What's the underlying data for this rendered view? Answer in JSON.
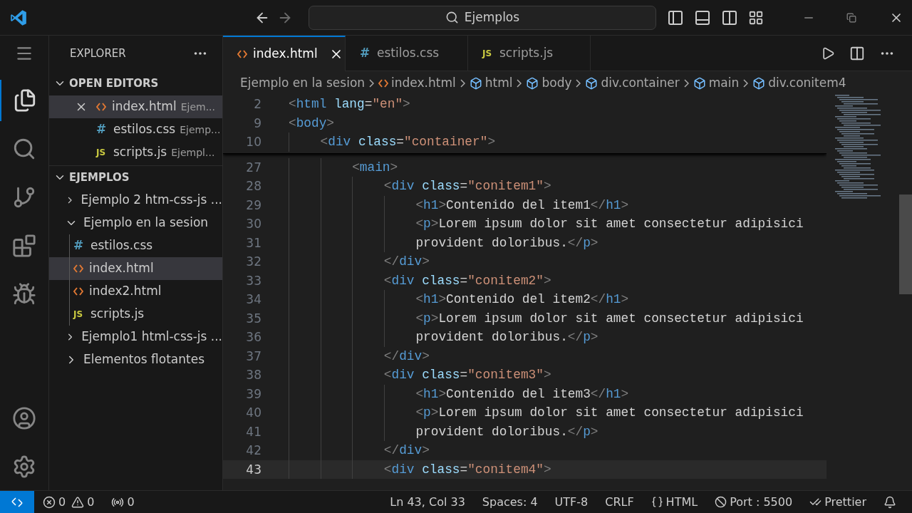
{
  "title_bar": {
    "search": "Ejemplos"
  },
  "sidebar": {
    "title": "EXPLORER",
    "open_editors": {
      "title": "OPEN EDITORS",
      "expanded": true,
      "items": [
        {
          "kind": "html",
          "name": "index.html",
          "folder": "Ejem...",
          "selected": true
        },
        {
          "kind": "css",
          "glyph": "#",
          "name": "estilos.css",
          "folder": "Ejemp...",
          "selected": false
        },
        {
          "kind": "js",
          "glyph": "JS",
          "name": "scripts.js",
          "folder": "Ejempl...",
          "selected": false
        }
      ]
    },
    "workspace": {
      "title": "EJEMPLOS",
      "expanded": true,
      "items": [
        {
          "kind": "folder",
          "name": "Ejemplo 2 htm-css-js ...",
          "expanded": false,
          "selected": false
        },
        {
          "kind": "folder",
          "name": "Ejemplo en la sesion",
          "expanded": true,
          "selected": false,
          "children": [
            {
              "kind": "css",
              "glyph": "#",
              "name": "estilos.css",
              "selected": false
            },
            {
              "kind": "html",
              "name": "index.html",
              "selected": true
            },
            {
              "kind": "html",
              "name": "index2.html",
              "selected": false
            },
            {
              "kind": "js",
              "glyph": "JS",
              "name": "scripts.js",
              "selected": false
            }
          ]
        },
        {
          "kind": "folder",
          "name": "Ejemplo1 html-css-js ...",
          "expanded": false,
          "selected": false
        },
        {
          "kind": "folder",
          "name": "Elementos flotantes",
          "expanded": false,
          "selected": false
        }
      ]
    }
  },
  "tabs": [
    {
      "kind": "html",
      "name": "index.html",
      "selected": true
    },
    {
      "kind": "css",
      "glyph": "#",
      "name": "estilos.css",
      "selected": false
    },
    {
      "kind": "js",
      "glyph": "JS",
      "name": "scripts.js",
      "selected": false
    }
  ],
  "breadcrumbs": [
    {
      "kind": "folder",
      "label": "Ejemplo en la sesion"
    },
    {
      "kind": "html",
      "label": "index.html"
    },
    {
      "kind": "element",
      "label": "html"
    },
    {
      "kind": "element",
      "label": "body"
    },
    {
      "kind": "element",
      "label": "div.container"
    },
    {
      "kind": "element",
      "label": "main"
    },
    {
      "kind": "element",
      "label": "div.conitem4"
    }
  ],
  "sticky_lines": [
    {
      "number": "2",
      "tokens": [
        {
          "kind": "punct",
          "text": "<"
        },
        {
          "kind": "tag",
          "text": "html"
        },
        {
          "kind": "attr",
          "text": " lang"
        },
        {
          "kind": "plain",
          "text": "="
        },
        {
          "kind": "string",
          "text": "\"en\""
        },
        {
          "kind": "punct",
          "text": ">"
        }
      ]
    },
    {
      "number": "9",
      "tokens": [
        {
          "kind": "punct",
          "text": "<"
        },
        {
          "kind": "tag",
          "text": "body"
        },
        {
          "kind": "punct",
          "text": ">"
        }
      ],
      "children": [
        {
          "number": "10",
          "tokens": [
            {
              "kind": "punct",
              "text": "<"
            },
            {
              "kind": "tag",
              "text": "div"
            },
            {
              "kind": "attr",
              "text": " class"
            },
            {
              "kind": "plain",
              "text": "="
            },
            {
              "kind": "string",
              "text": "\"container\""
            },
            {
              "kind": "punct",
              "text": ">"
            }
          ]
        }
      ]
    }
  ],
  "lines": [
    {
      "number": "27",
      "current": false,
      "tokens": [
        {
          "kind": "punct",
          "text": "<"
        },
        {
          "kind": "tag",
          "text": "main"
        },
        {
          "kind": "punct",
          "text": ">"
        }
      ],
      "children": [
        {
          "number": "28",
          "current": false,
          "tokens": [
            {
              "kind": "punct",
              "text": "<"
            },
            {
              "kind": "tag",
              "text": "div"
            },
            {
              "kind": "attr",
              "text": " class"
            },
            {
              "kind": "plain",
              "text": "="
            },
            {
              "kind": "string",
              "text": "\"conitem1\""
            },
            {
              "kind": "punct",
              "text": ">"
            }
          ],
          "children": [
            {
              "number": "29",
              "current": false,
              "tokens": [
                {
                  "kind": "punct",
                  "text": "<"
                },
                {
                  "kind": "tag",
                  "text": "h1"
                },
                {
                  "kind": "punct",
                  "text": ">"
                },
                {
                  "kind": "plain",
                  "text": "Contenido del item1"
                },
                {
                  "kind": "punct",
                  "text": "</"
                },
                {
                  "kind": "tag",
                  "text": "h1"
                },
                {
                  "kind": "punct",
                  "text": ">"
                }
              ]
            },
            {
              "number": "30",
              "current": false,
              "tokens": [
                {
                  "kind": "punct",
                  "text": "<"
                },
                {
                  "kind": "tag",
                  "text": "p"
                },
                {
                  "kind": "punct",
                  "text": ">"
                },
                {
                  "kind": "plain",
                  "text": "Lorem ipsum dolor sit amet consectetur adipisici"
                }
              ]
            },
            {
              "number": "31",
              "current": false,
              "tokens": [
                {
                  "kind": "plain",
                  "text": "provident doloribus."
                },
                {
                  "kind": "punct",
                  "text": "</"
                },
                {
                  "kind": "tag",
                  "text": "p"
                },
                {
                  "kind": "punct",
                  "text": ">"
                }
              ]
            }
          ]
        },
        {
          "number": "32",
          "current": false,
          "tokens": [
            {
              "kind": "punct",
              "text": "</"
            },
            {
              "kind": "tag",
              "text": "div"
            },
            {
              "kind": "punct",
              "text": ">"
            }
          ]
        },
        {
          "number": "33",
          "current": false,
          "tokens": [
            {
              "kind": "punct",
              "text": "<"
            },
            {
              "kind": "tag",
              "text": "div"
            },
            {
              "kind": "attr",
              "text": " class"
            },
            {
              "kind": "plain",
              "text": "="
            },
            {
              "kind": "string",
              "text": "\"conitem2\""
            },
            {
              "kind": "punct",
              "text": ">"
            }
          ],
          "children": [
            {
              "number": "34",
              "current": false,
              "tokens": [
                {
                  "kind": "punct",
                  "text": "<"
                },
                {
                  "kind": "tag",
                  "text": "h1"
                },
                {
                  "kind": "punct",
                  "text": ">"
                },
                {
                  "kind": "plain",
                  "text": "Contenido del item2"
                },
                {
                  "kind": "punct",
                  "text": "</"
                },
                {
                  "kind": "tag",
                  "text": "h1"
                },
                {
                  "kind": "punct",
                  "text": ">"
                }
              ]
            },
            {
              "number": "35",
              "current": false,
              "tokens": [
                {
                  "kind": "punct",
                  "text": "<"
                },
                {
                  "kind": "tag",
                  "text": "p"
                },
                {
                  "kind": "punct",
                  "text": ">"
                },
                {
                  "kind": "plain",
                  "text": "Lorem ipsum dolor sit amet consectetur adipisici"
                }
              ]
            },
            {
              "number": "36",
              "current": false,
              "tokens": [
                {
                  "kind": "plain",
                  "text": "provident doloribus."
                },
                {
                  "kind": "punct",
                  "text": "</"
                },
                {
                  "kind": "tag",
                  "text": "p"
                },
                {
                  "kind": "punct",
                  "text": ">"
                }
              ]
            }
          ]
        },
        {
          "number": "37",
          "current": false,
          "tokens": [
            {
              "kind": "punct",
              "text": "</"
            },
            {
              "kind": "tag",
              "text": "div"
            },
            {
              "kind": "punct",
              "text": ">"
            }
          ]
        },
        {
          "number": "38",
          "current": false,
          "tokens": [
            {
              "kind": "punct",
              "text": "<"
            },
            {
              "kind": "tag",
              "text": "div"
            },
            {
              "kind": "attr",
              "text": " class"
            },
            {
              "kind": "plain",
              "text": "="
            },
            {
              "kind": "string",
              "text": "\"conitem3\""
            },
            {
              "kind": "punct",
              "text": ">"
            }
          ],
          "children": [
            {
              "number": "39",
              "current": false,
              "tokens": [
                {
                  "kind": "punct",
                  "text": "<"
                },
                {
                  "kind": "tag",
                  "text": "h1"
                },
                {
                  "kind": "punct",
                  "text": ">"
                },
                {
                  "kind": "plain",
                  "text": "Contenido del item3"
                },
                {
                  "kind": "punct",
                  "text": "</"
                },
                {
                  "kind": "tag",
                  "text": "h1"
                },
                {
                  "kind": "punct",
                  "text": ">"
                }
              ]
            },
            {
              "number": "40",
              "current": false,
              "tokens": [
                {
                  "kind": "punct",
                  "text": "<"
                },
                {
                  "kind": "tag",
                  "text": "p"
                },
                {
                  "kind": "punct",
                  "text": ">"
                },
                {
                  "kind": "plain",
                  "text": "Lorem ipsum dolor sit amet consectetur adipisici"
                }
              ]
            },
            {
              "number": "41",
              "current": false,
              "tokens": [
                {
                  "kind": "plain",
                  "text": "provident doloribus."
                },
                {
                  "kind": "punct",
                  "text": "</"
                },
                {
                  "kind": "tag",
                  "text": "p"
                },
                {
                  "kind": "punct",
                  "text": ">"
                }
              ]
            }
          ]
        },
        {
          "number": "42",
          "current": false,
          "tokens": [
            {
              "kind": "punct",
              "text": "</"
            },
            {
              "kind": "tag",
              "text": "div"
            },
            {
              "kind": "punct",
              "text": ">"
            }
          ]
        },
        {
          "number": "43",
          "current": true,
          "tokens": [
            {
              "kind": "punct",
              "text": "<"
            },
            {
              "kind": "tag",
              "text": "div"
            },
            {
              "kind": "attr",
              "text": " class"
            },
            {
              "kind": "plain",
              "text": "="
            },
            {
              "kind": "string",
              "text": "\"conitem4\""
            },
            {
              "kind": "punct",
              "text": ">"
            }
          ]
        }
      ]
    }
  ],
  "status_bar": {
    "errors": "0",
    "warnings": "0",
    "ports": "0",
    "position": "Ln 43, Col 33",
    "spaces": "Spaces: 4",
    "encoding": "UTF-8",
    "eol": "CRLF",
    "language": "HTML",
    "port": "Port : 5500",
    "formatter": "Prettier"
  }
}
